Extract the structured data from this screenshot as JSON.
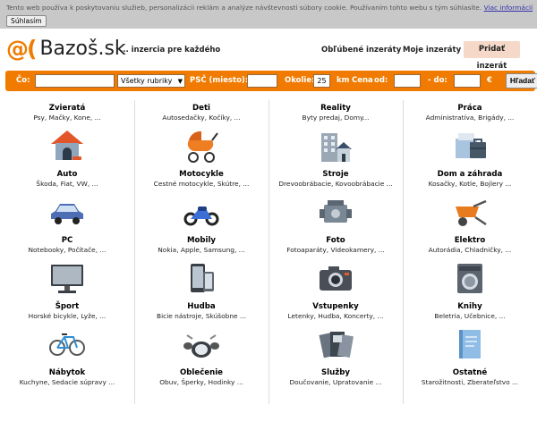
{
  "cookie": {
    "text": "Tento web používa k poskytovaniu služieb, personalizácii reklám a analýze návštevnosti súbory cookie. Používaním tohto webu s tým súhlasíte.",
    "link": "Viac informácií",
    "button": "Súhlasím"
  },
  "header": {
    "logo_mark": "@(",
    "logo_text": "Bazoš.sk",
    "tagline": "... inzercia pre každého",
    "nav_favorites": "Obľúbené inzeráty",
    "nav_mine": "Moje inzeráty",
    "add_button": "Pridať inzerát"
  },
  "search": {
    "what_label": "Čo:",
    "what_value": "",
    "category_value": "Všetky rubriky",
    "zip_label": "PSČ (miesto):",
    "zip_value": "",
    "radius_label": "Okolie:",
    "radius_value": "25",
    "km_label": "km",
    "price_label": "Cena",
    "from_label": "od:",
    "price_from": "",
    "to_label": "- do:",
    "price_to": "",
    "currency": "€",
    "submit": "Hľadať"
  },
  "categories": [
    {
      "title": "Zvieratá",
      "sub": "Psy, Mačky, Kone, ...",
      "icon": "doghouse-icon"
    },
    {
      "title": "Deti",
      "sub": "Autosedačky, Kočíky, ...",
      "icon": "stroller-icon"
    },
    {
      "title": "Reality",
      "sub": "Byty predaj, Domy...",
      "icon": "buildings-icon"
    },
    {
      "title": "Práca",
      "sub": "Administratíva, Brigády, ...",
      "icon": "briefcase-icon"
    },
    {
      "title": "Auto",
      "sub": "Škoda, Fiat, VW, ...",
      "icon": "car-icon"
    },
    {
      "title": "Motocykle",
      "sub": "Cestné motocykle, Skútre, ...",
      "icon": "motorcycle-icon"
    },
    {
      "title": "Stroje",
      "sub": "Drevoobrábacie, Kovoobrábacie ...",
      "icon": "engine-icon"
    },
    {
      "title": "Dom a záhrada",
      "sub": "Kosačky, Kotle, Bojlery ...",
      "icon": "wheelbarrow-icon"
    },
    {
      "title": "PC",
      "sub": "Notebooky, Počítače, ...",
      "icon": "monitor-icon"
    },
    {
      "title": "Mobily",
      "sub": "Nokia, Apple, Samsung, ...",
      "icon": "phone-icon"
    },
    {
      "title": "Foto",
      "sub": "Fotoaparáty, Videokamery, ...",
      "icon": "camera-icon"
    },
    {
      "title": "Elektro",
      "sub": "Autorádia, Chladničky, ...",
      "icon": "washer-icon"
    },
    {
      "title": "Šport",
      "sub": "Horské bicykle, Lyže, ...",
      "icon": "bicycle-icon"
    },
    {
      "title": "Hudba",
      "sub": "Bicie nástroje, Skúšobne ...",
      "icon": "drums-icon"
    },
    {
      "title": "Vstupenky",
      "sub": "Letenky, Hudba, Koncerty, ...",
      "icon": "tickets-icon"
    },
    {
      "title": "Knihy",
      "sub": "Beletria, Učebnice, ...",
      "icon": "book-icon"
    },
    {
      "title": "Nábytok",
      "sub": "Kuchyne, Sedacie súpravy ...",
      "icon": "furniture-icon"
    },
    {
      "title": "Oblečenie",
      "sub": "Obuv, Šperky, Hodinky ...",
      "icon": "clothes-icon"
    },
    {
      "title": "Služby",
      "sub": "Doučovanie, Upratovanie ...",
      "icon": "services-icon"
    },
    {
      "title": "Ostatné",
      "sub": "Starožitnosti, Zberateľstvo ...",
      "icon": "other-icon"
    }
  ],
  "colors": {
    "brand": "#f07b00",
    "add_button_bg": "#f5d8c8"
  }
}
